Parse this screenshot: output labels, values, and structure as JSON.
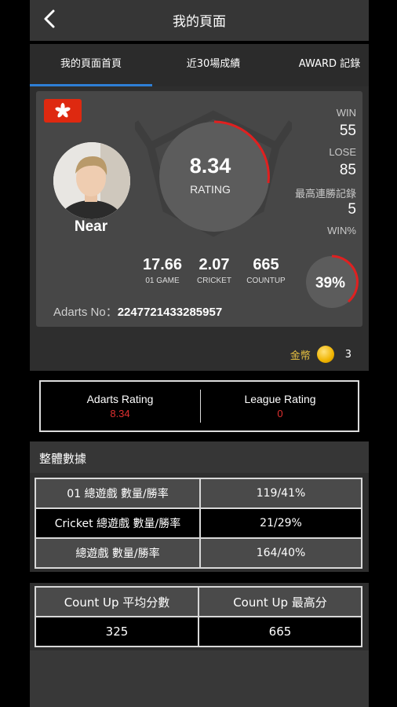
{
  "header": {
    "title": "我的頁面"
  },
  "tabs": [
    {
      "label": "我的頁面首頁",
      "active": true
    },
    {
      "label": "近30場成績",
      "active": false
    },
    {
      "label": "AWARD 記錄",
      "active": false
    }
  ],
  "profile": {
    "name": "Near",
    "rating": "8.34",
    "rating_label": "RATING",
    "stats": {
      "win_label": "WIN",
      "win": "55",
      "lose_label": "LOSE",
      "lose": "85",
      "streak_label": "最高連勝記錄",
      "streak": "5",
      "winpct_label": "WIN%"
    },
    "win_percent": "39%",
    "mini": [
      {
        "value": "17.66",
        "label": "01 GAME"
      },
      {
        "value": "2.07",
        "label": "CRICKET"
      },
      {
        "value": "665",
        "label": "COUNTUP"
      }
    ],
    "adarts_no_label": "Adarts No：",
    "adarts_no": "2247721433285957",
    "coins_label": "金幣",
    "coins": "3"
  },
  "ratings": {
    "adarts_label": "Adarts Rating",
    "adarts_value": "8.34",
    "league_label": "League Rating",
    "league_value": "0"
  },
  "overall": {
    "title": "整體數據",
    "rows": [
      {
        "label": "01 總遊戲 數量/勝率",
        "value": "119/41%"
      },
      {
        "label": "Cricket 總遊戲 數量/勝率",
        "value": "21/29%"
      },
      {
        "label": "總遊戲 數量/勝率",
        "value": "164/40%"
      }
    ]
  },
  "countup": {
    "avg_label": "Count Up 平均分數",
    "avg_value": "325",
    "max_label": "Count Up 最高分",
    "max_value": "665"
  },
  "colors": {
    "accent_blue": "#2e7fd6",
    "ring_red": "#e02020",
    "value_red": "#e03030",
    "coin_gold": "#f0b400"
  }
}
